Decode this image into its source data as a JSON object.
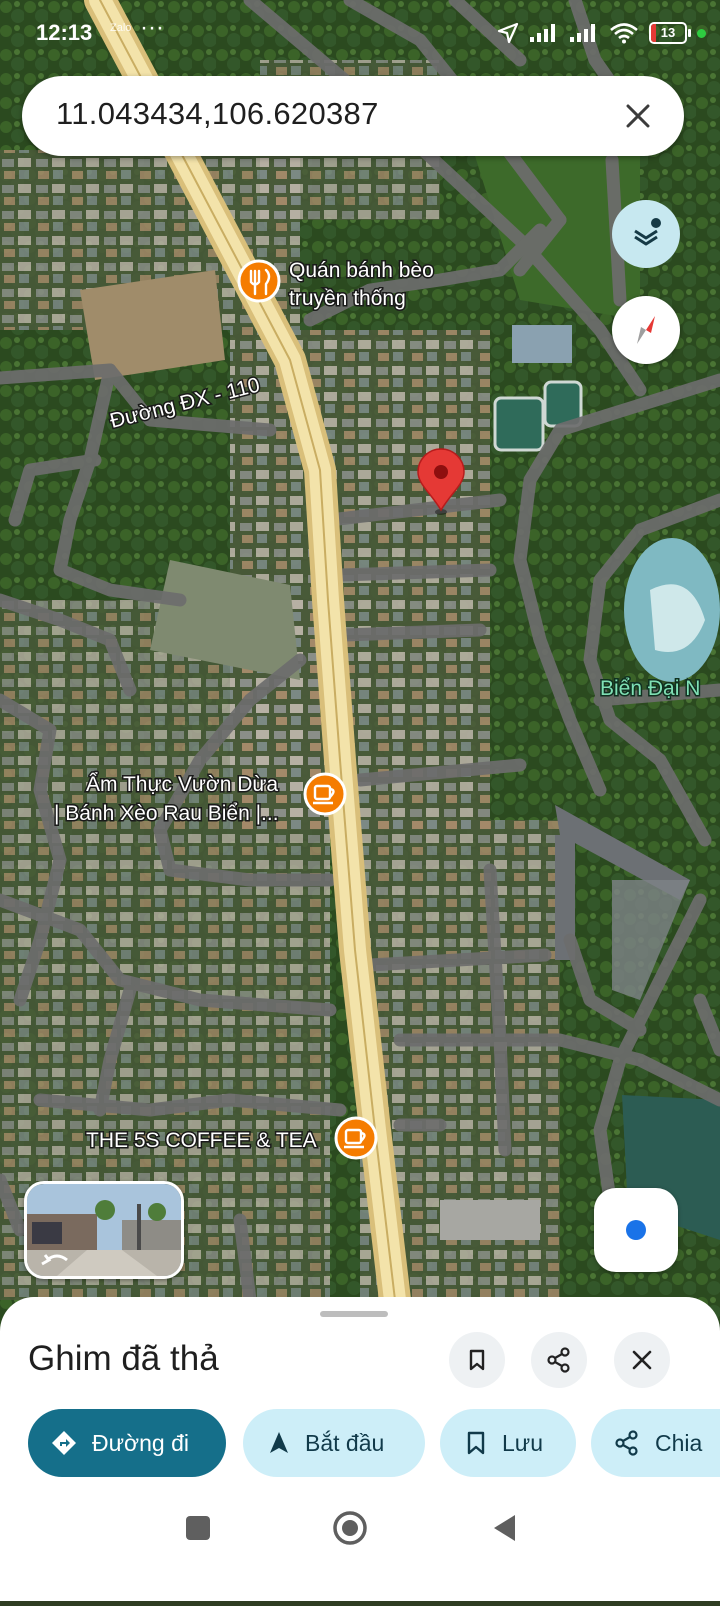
{
  "status_bar": {
    "time": "12:13",
    "app_indicator": "Zalo",
    "more_dots": "···",
    "battery": "13"
  },
  "search": {
    "query": "11.043434,106.620387",
    "clear_icon": "close-icon"
  },
  "map": {
    "type": "satellite",
    "road_label": "Đường ĐX - 110",
    "area_label": "Biển Đại N",
    "places": [
      {
        "line1": "Quán bánh bèo",
        "line2": "truyền thống",
        "icon": "restaurant-icon"
      },
      {
        "line1": "Ẩm Thực Vườn Dừa",
        "line2": "| Bánh Xèo Rau Biển |...",
        "icon": "cafe-icon"
      },
      {
        "line1": "THE 5S COFFEE & TEA",
        "line2": "",
        "icon": "cafe-icon"
      }
    ],
    "pin_color": "#e53935"
  },
  "controls": {
    "layers_icon": "layers-icon",
    "compass_icon": "compass-icon",
    "my_location_icon": "my-location-icon",
    "street_view": "street-view-thumbnail"
  },
  "sheet": {
    "title": "Ghim đã thả",
    "save_icon": "bookmark-icon",
    "share_icon": "share-icon",
    "close_icon": "close-icon",
    "actions": {
      "directions": "Đường đi",
      "start": "Bắt đầu",
      "save": "Lưu",
      "share": "Chia"
    }
  },
  "colors": {
    "accent": "#156f8a",
    "chip": "#cdeef8",
    "pin": "#e53935",
    "place_icon": "#f57c00",
    "road_main": "#e9d59a",
    "road_minor": "#6d6d6d"
  }
}
